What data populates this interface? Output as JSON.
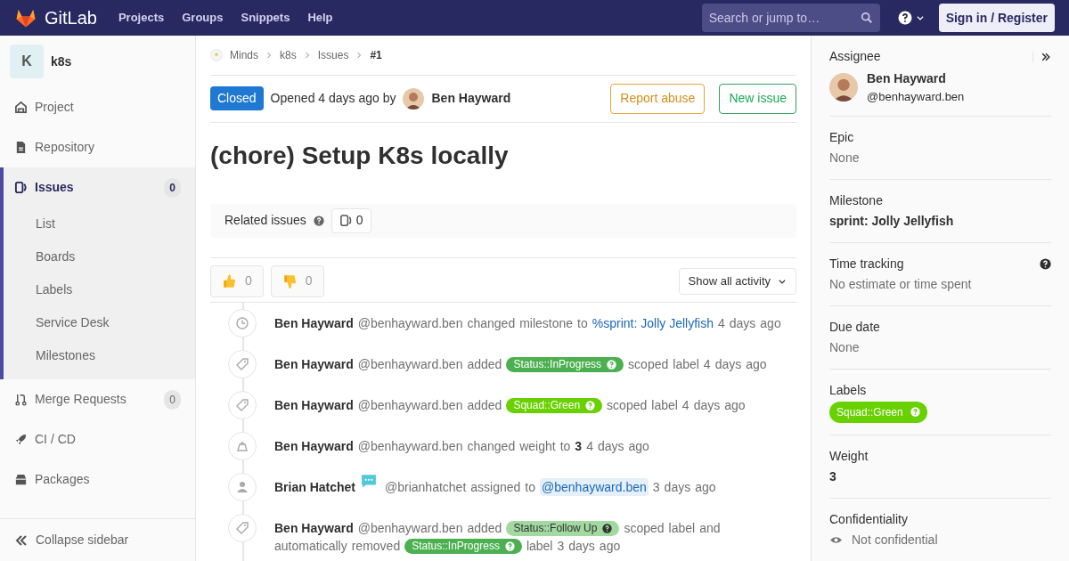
{
  "header": {
    "brand": "GitLab",
    "nav": [
      "Projects",
      "Groups",
      "Snippets",
      "Help"
    ],
    "search": {
      "placeholder": "Search or jump to…"
    },
    "sign_in": "Sign in / Register"
  },
  "sidebar": {
    "project_initial": "K",
    "project_name": "k8s",
    "items": [
      {
        "label": "Project",
        "selected": false
      },
      {
        "label": "Repository",
        "selected": false
      },
      {
        "label": "Issues",
        "selected": true,
        "count": "0",
        "children": [
          {
            "label": "List"
          },
          {
            "label": "Boards"
          },
          {
            "label": "Labels"
          },
          {
            "label": "Service Desk"
          },
          {
            "label": "Milestones"
          }
        ]
      },
      {
        "label": "Merge Requests",
        "selected": false,
        "count": "0"
      },
      {
        "label": "CI / CD",
        "selected": false
      },
      {
        "label": "Packages",
        "selected": false
      }
    ],
    "collapse": "Collapse sidebar"
  },
  "breadcrumbs": [
    "Minds",
    "k8s",
    "Issues",
    "#1"
  ],
  "issue": {
    "status": "Closed",
    "opened": "Opened 4 days ago by",
    "author": "Ben Hayward",
    "report": "Report abuse",
    "new_issue": "New issue",
    "title": "(chore) Setup K8s locally",
    "related_label": "Related issues",
    "related_count": "0",
    "thumbs_up": "0",
    "thumbs_down": "0",
    "activity_filter": "Show all activity"
  },
  "activity": [
    {
      "kind": "milestone",
      "parts": [
        {
          "kind": "author",
          "text": "Ben Hayward"
        },
        {
          "kind": "text",
          "text": "@benhayward.ben changed milestone to"
        },
        {
          "kind": "link",
          "text": "%sprint: Jolly Jellyfish"
        },
        {
          "kind": "text",
          "text": "4 days ago"
        }
      ]
    },
    {
      "kind": "label",
      "parts": [
        {
          "kind": "author",
          "text": "Ben Hayward"
        },
        {
          "kind": "text",
          "text": "@benhayward.ben added"
        },
        {
          "kind": "label",
          "text": "Status::InProgress",
          "color": "#4cb051"
        },
        {
          "kind": "text",
          "text": "scoped label 4 days ago"
        }
      ]
    },
    {
      "kind": "label",
      "parts": [
        {
          "kind": "author",
          "text": "Ben Hayward"
        },
        {
          "kind": "text",
          "text": "@benhayward.ben added"
        },
        {
          "kind": "label",
          "text": "Squad::Green",
          "color": "#69d100"
        },
        {
          "kind": "text",
          "text": "scoped label 4 days ago"
        }
      ]
    },
    {
      "kind": "weight",
      "parts": [
        {
          "kind": "author",
          "text": "Ben Hayward"
        },
        {
          "kind": "text",
          "text": "@benhayward.ben changed weight to"
        },
        {
          "kind": "bold",
          "text": "3"
        },
        {
          "kind": "text",
          "text": "4 days ago"
        }
      ]
    },
    {
      "kind": "assignee",
      "parts": [
        {
          "kind": "author",
          "text": "Brian Hatchet"
        },
        {
          "kind": "chat"
        },
        {
          "kind": "text",
          "text": "@brianhatchet assigned to"
        },
        {
          "kind": "mention",
          "text": "@benhayward.ben"
        },
        {
          "kind": "text",
          "text": "3 days ago"
        }
      ]
    },
    {
      "kind": "label",
      "parts": [
        {
          "kind": "author",
          "text": "Ben Hayward"
        },
        {
          "kind": "text",
          "text": "@benhayward.ben added"
        },
        {
          "kind": "light_label",
          "text": "Status::Follow Up",
          "color": "#a2d9a0"
        },
        {
          "kind": "text",
          "text": "scoped label and automatically removed"
        },
        {
          "kind": "label",
          "text": "Status::InProgress",
          "color": "#4cb051"
        },
        {
          "kind": "text",
          "text": "label 3 days ago"
        }
      ]
    }
  ],
  "right_sidebar": {
    "assignee": {
      "label": "Assignee",
      "name": "Ben Hayward",
      "handle": "@benhayward.ben"
    },
    "sections": [
      {
        "kind": "text",
        "label": "Epic",
        "value": "None"
      },
      {
        "kind": "bold",
        "label": "Milestone",
        "value": "sprint: Jolly Jellyfish"
      },
      {
        "kind": "help",
        "label": "Time tracking",
        "value": "No estimate or time spent"
      },
      {
        "kind": "text",
        "label": "Due date",
        "value": "None"
      },
      {
        "kind": "label",
        "label": "Labels",
        "value": "Squad::Green",
        "color": "#69d100"
      },
      {
        "kind": "bold",
        "label": "Weight",
        "value": "3"
      },
      {
        "kind": "eye",
        "label": "Confidentiality",
        "value": "Not confidential"
      }
    ]
  }
}
